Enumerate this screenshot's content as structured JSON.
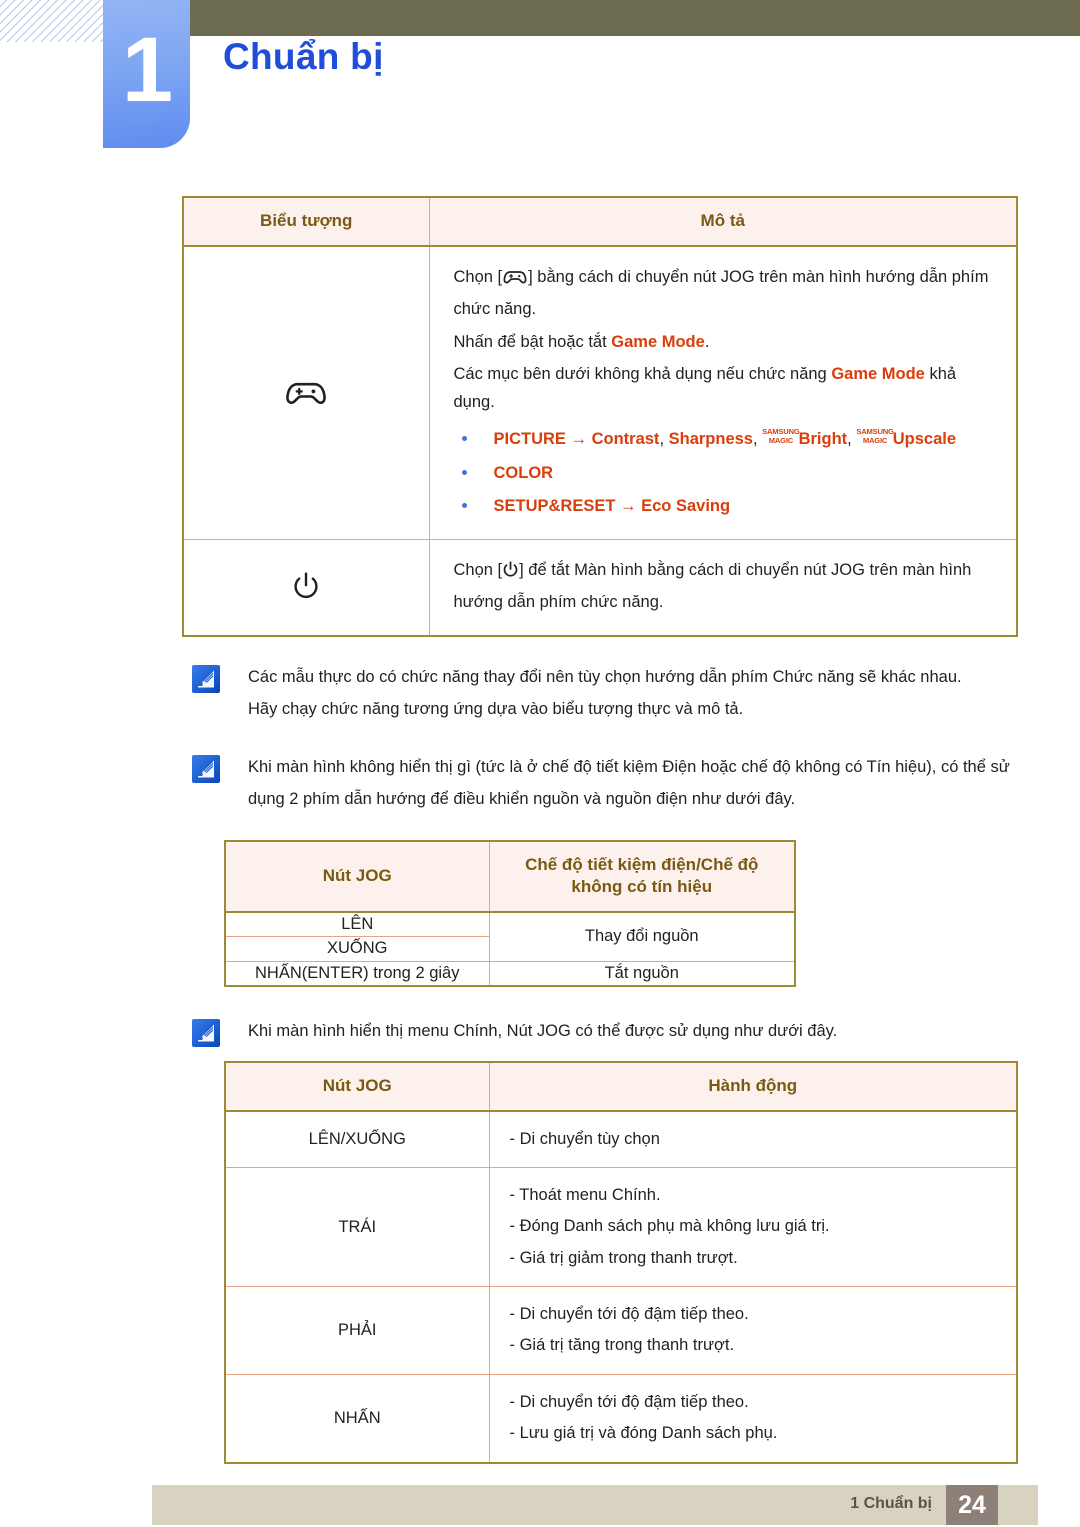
{
  "header": {
    "chapter_number": "1",
    "chapter_title": "Chuẩn bị",
    "title_color": "#1f4fd8",
    "bar_color": "#6e6b53"
  },
  "table_icons": {
    "headers": [
      "Biểu tượng",
      "Mô tả"
    ],
    "rows": [
      {
        "icon": "gamepad-icon",
        "lines": [
          "Chọn [ ] bằng cách di chuyển nút JOG trên màn hình hướng dẫn phím chức năng.",
          "Nhấn để bật hoặc tắt Game Mode."
        ],
        "line1_pre": "Chọn [",
        "line1_post": "] bằng cách di chuyển nút JOG trên màn hình hướng dẫn phím chức năng.",
        "line2_pre": "Nhấn để bật hoặc tắt ",
        "line2_kw": "Game Mode",
        "line2_post": ".",
        "line3_pre": "Các mục bên dưới không khả dụng nếu chức năng ",
        "line3_kw": "Game Mode",
        "line3_post": " khả dụng.",
        "features": [
          {
            "parts": [
              {
                "t": "PICTURE",
                "style": "kw"
              },
              {
                "t": " → ",
                "style": "kw"
              },
              {
                "t": "Contrast",
                "style": "kw"
              },
              {
                "t": ", ",
                "style": "sep"
              },
              {
                "t": "Sharpness",
                "style": "kw"
              },
              {
                "t": ", ",
                "style": "sep"
              },
              {
                "t": "SAMSUNG",
                "style": "magic-top"
              },
              {
                "t": "MAGIC",
                "style": "magic-bottom"
              },
              {
                "t": "Bright",
                "style": "kw"
              },
              {
                "t": ", ",
                "style": "sep"
              },
              {
                "t": "SAMSUNG",
                "style": "magic-top"
              },
              {
                "t": "MAGIC",
                "style": "magic-bottom"
              },
              {
                "t": "Upscale",
                "style": "kw"
              }
            ]
          },
          {
            "parts": [
              {
                "t": "COLOR",
                "style": "kw"
              }
            ]
          },
          {
            "parts": [
              {
                "t": "SETUP&RESET",
                "style": "kw"
              },
              {
                "t": " → ",
                "style": "kw"
              },
              {
                "t": "Eco Saving",
                "style": "kw"
              }
            ]
          }
        ]
      },
      {
        "icon": "power-icon",
        "power_pre": "Chọn [",
        "power_post": "] để tắt Màn hình bằng cách di chuyển nút JOG trên màn hình hướng dẫn phím chức năng."
      }
    ]
  },
  "notes": [
    {
      "icon": "note-icon",
      "lines": [
        "Các mẫu thực do có chức năng thay đổi nên tùy chọn hướng dẫn phím Chức năng sẽ khác nhau.",
        "Hãy chạy chức năng tương ứng dựa vào biểu tượng thực và mô tả."
      ]
    },
    {
      "icon": "note-icon",
      "lines": [
        "Khi màn hình không hiển thị gì (tức là ở chế độ tiết kiệm Điện hoặc chế độ không có Tín hiệu), có thể sử dụng 2 phím dẫn hướng để điều khiển nguồn và nguồn điện như dưới đây."
      ]
    },
    {
      "icon": "note-icon",
      "lines": [
        "Khi màn hình hiển thị menu Chính, Nút JOG có thể được sử dụng như dưới đây."
      ]
    }
  ],
  "table_power": {
    "headers": [
      "Nút JOG",
      "Chế độ tiết kiệm điện/Chế độ không có tín hiệu"
    ],
    "header2_line1": "Chế độ tiết kiệm điện/Chế độ",
    "header2_line2": "không có tín hiệu",
    "rows": [
      {
        "key": "LÊN",
        "value": "Thay đổi nguồn",
        "rowspan": 2
      },
      {
        "key": "XUỐNG"
      },
      {
        "key": "NHẤN(ENTER) trong 2 giây",
        "value": "Tắt nguồn"
      }
    ]
  },
  "table_action": {
    "headers": [
      "Nút JOG",
      "Hành động"
    ],
    "rows": [
      {
        "key": "LÊN/XUỐNG",
        "actions": [
          "- Di chuyển tùy chọn"
        ]
      },
      {
        "key": "TRÁI",
        "actions": [
          "- Thoát menu Chính.",
          "- Đóng Danh sách phụ mà không lưu giá trị.",
          "- Giá trị giảm trong thanh trượt."
        ]
      },
      {
        "key": "PHẢI",
        "actions": [
          "- Di chuyển tới độ đậm tiếp theo.",
          "- Giá trị tăng trong thanh trượt."
        ]
      },
      {
        "key": "NHẤN",
        "actions": [
          "- Di chuyển tới độ đậm tiếp theo.",
          "- Lưu giá trị và đóng Danh sách phụ."
        ]
      }
    ]
  },
  "footer": {
    "label": "1 Chuẩn bị",
    "page": "24",
    "bar_color": "#d8d2c0",
    "page_box_color": "#8d8077"
  }
}
